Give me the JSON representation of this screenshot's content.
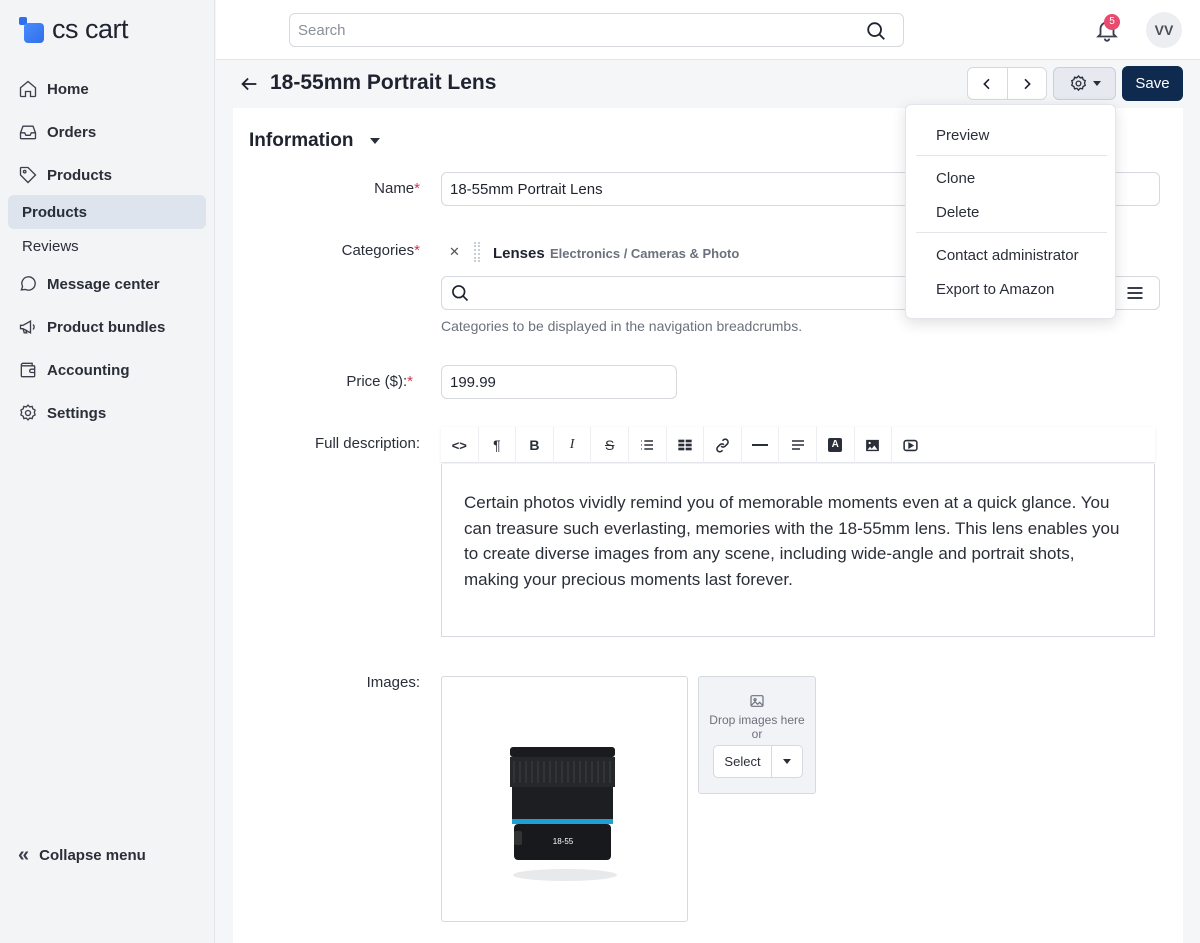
{
  "app": {
    "logo_text": "cs cart"
  },
  "sidebar": {
    "items": [
      {
        "label": "Home",
        "icon": "home-icon"
      },
      {
        "label": "Orders",
        "icon": "inbox-icon"
      },
      {
        "label": "Products",
        "icon": "tag-icon"
      },
      {
        "label": "Message center",
        "icon": "chat-icon"
      },
      {
        "label": "Product bundles",
        "icon": "megaphone-icon"
      },
      {
        "label": "Accounting",
        "icon": "wallet-icon"
      },
      {
        "label": "Settings",
        "icon": "gear-icon"
      }
    ],
    "products_sub": [
      {
        "label": "Products",
        "active": true
      },
      {
        "label": "Reviews",
        "active": false
      }
    ],
    "collapse_label": "Collapse menu"
  },
  "topbar": {
    "search_placeholder": "Search",
    "notification_count": "5",
    "avatar_initials": "VV"
  },
  "header": {
    "title": "18-55mm Portrait Lens",
    "save_label": "Save"
  },
  "menu": {
    "items": [
      "Preview",
      "Clone",
      "Delete",
      "Contact administrator",
      "Export to Amazon"
    ]
  },
  "form": {
    "section_title": "Information",
    "name_label": "Name",
    "name_value": "18-55mm Portrait Lens",
    "categories_label": "Categories",
    "category_name": "Lenses",
    "category_path": "Electronics / Cameras & Photo",
    "categories_hint": "Categories to be displayed in the navigation breadcrumbs.",
    "price_label": "Price ($):",
    "price_value": "199.99",
    "description_label": "Full description:",
    "description_text": "Certain photos vividly remind you of memorable moments even at a quick glance. You can treasure such everlasting, memories with the 18-55mm lens. This lens enables you to create diverse images from any scene, including wide-angle and portrait shots, making your precious moments last forever.",
    "images_label": "Images:",
    "drop_text_1": "Drop images here",
    "drop_text_2": "or",
    "select_label": "Select",
    "lens_text": "18-55"
  },
  "colors": {
    "accent": "#0e2a4f",
    "badge": "#e74b6d",
    "active_nav": "#dde4ee"
  }
}
